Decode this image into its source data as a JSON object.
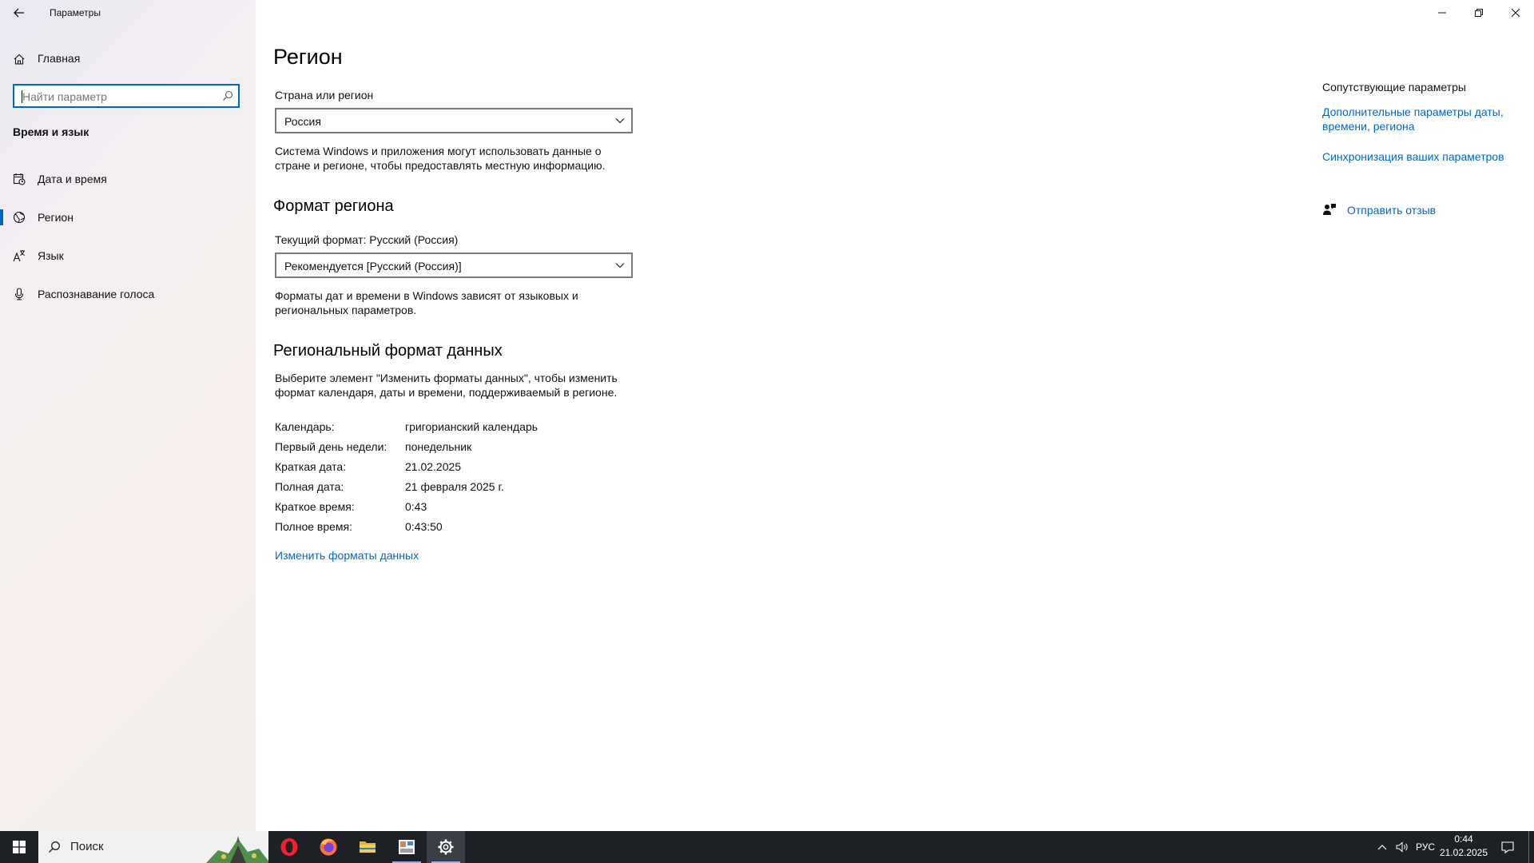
{
  "window": {
    "title": "Параметры",
    "minimize_icon": "minimize-icon",
    "restore_icon": "restore-icon",
    "close_icon": "close-icon"
  },
  "sidebar": {
    "home_label": "Главная",
    "search_placeholder": "Найти параметр",
    "section_title": "Время и язык",
    "items": [
      {
        "label": "Дата и время",
        "icon": "calendar-clock-icon",
        "selected": false
      },
      {
        "label": "Регион",
        "icon": "globe-icon",
        "selected": true
      },
      {
        "label": "Язык",
        "icon": "language-icon",
        "selected": false
      },
      {
        "label": "Распознавание голоса",
        "icon": "microphone-icon",
        "selected": false
      }
    ]
  },
  "main": {
    "title": "Регион",
    "country": {
      "label": "Страна или регион",
      "value": "Россия",
      "description": "Система Windows и приложения могут использовать данные о стране и регионе, чтобы предоставлять местную информацию."
    },
    "format": {
      "heading": "Формат региона",
      "current_label": "Текущий формат: Русский (Россия)",
      "value": "Рекомендуется [Русский (Россия)]",
      "description": "Форматы дат и времени в Windows зависят от языковых и региональных параметров."
    },
    "regional_data": {
      "heading": "Региональный формат данных",
      "description": "Выберите элемент \"Изменить форматы данных\", чтобы изменить формат календаря, даты и времени, поддерживаемый в регионе.",
      "rows": [
        {
          "key": "Календарь:",
          "value": "григорианский календарь"
        },
        {
          "key": "Первый день недели:",
          "value": "понедельник"
        },
        {
          "key": "Краткая дата:",
          "value": "21.02.2025"
        },
        {
          "key": "Полная дата:",
          "value": "21 февраля 2025 г."
        },
        {
          "key": "Краткое время:",
          "value": "0:43"
        },
        {
          "key": "Полное время:",
          "value": "0:43:50"
        }
      ],
      "change_link": "Изменить форматы данных"
    }
  },
  "related": {
    "title": "Сопутствующие параметры",
    "links": [
      "Дополнительные параметры даты, времени, региона",
      "Синхронизация ваших параметров"
    ],
    "feedback": "Отправить отзыв"
  },
  "taskbar": {
    "search_text": "Поиск",
    "apps": [
      {
        "name": "opera-icon",
        "active": false
      },
      {
        "name": "firefox-icon",
        "active": false
      },
      {
        "name": "file-explorer-icon",
        "active": false
      },
      {
        "name": "paint-app-icon",
        "active": false
      },
      {
        "name": "settings-gear-icon",
        "active": true
      }
    ],
    "language": "РУС",
    "time": "0:44",
    "date": "21.02.2025"
  },
  "colors": {
    "accent": "#0067c0",
    "taskbar": "#1d2126"
  }
}
